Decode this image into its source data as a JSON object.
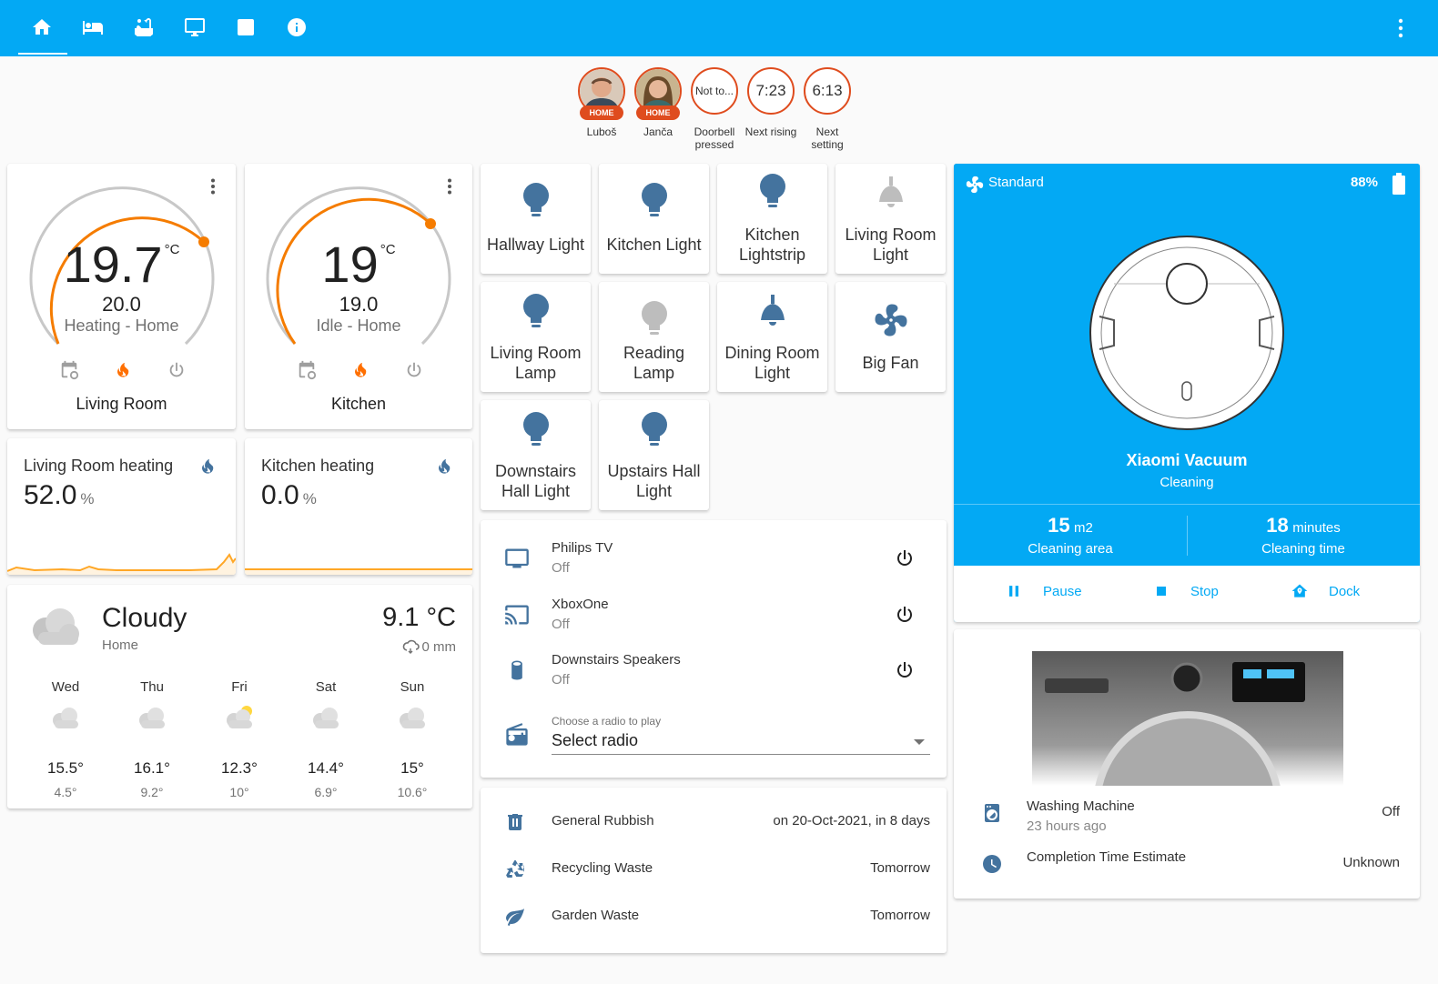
{
  "toolbar": {
    "tabs": [
      "home-icon",
      "bed-icon",
      "bathtub-icon",
      "monitor-icon",
      "image-icon",
      "info-icon"
    ],
    "menu": "dots-vertical-icon",
    "accent": "#03a9f4"
  },
  "badges": [
    {
      "value": "",
      "tag": "HOME",
      "label": "Luboš"
    },
    {
      "value": "",
      "tag": "HOME",
      "label": "Janča"
    },
    {
      "value": "Not to...",
      "tag": "",
      "label": "Doorbell pressed"
    },
    {
      "value": "7:23",
      "tag": "",
      "label": "Next rising"
    },
    {
      "value": "6:13",
      "tag": "",
      "label": "Next setting"
    }
  ],
  "thermostats": [
    {
      "current": "19.7",
      "unit": "°C",
      "target": "20.0",
      "mode": "Heating - Home",
      "name": "Living Room",
      "level": 0.73
    },
    {
      "current": "19",
      "unit": "°C",
      "target": "19.0",
      "mode": "Idle - Home",
      "name": "Kitchen",
      "level": 0.66
    }
  ],
  "sensors": [
    {
      "title": "Living Room heating",
      "value": "52.0",
      "unit": "%"
    },
    {
      "title": "Kitchen heating",
      "value": "0.0",
      "unit": "%"
    }
  ],
  "weather": {
    "condition": "Cloudy",
    "location": "Home",
    "temperature": "9.1 °C",
    "precipitation": "0 mm",
    "forecast": [
      {
        "day": "Wed",
        "high": "15.5°",
        "low": "4.5°",
        "icon": "cloudy-icon"
      },
      {
        "day": "Thu",
        "high": "16.1°",
        "low": "9.2°",
        "icon": "cloudy-icon"
      },
      {
        "day": "Fri",
        "high": "12.3°",
        "low": "10°",
        "icon": "partly-cloudy-icon"
      },
      {
        "day": "Sat",
        "high": "14.4°",
        "low": "6.9°",
        "icon": "cloudy-icon"
      },
      {
        "day": "Sun",
        "high": "15°",
        "low": "10.6°",
        "icon": "cloudy-icon"
      }
    ]
  },
  "lights": [
    {
      "name": "Hallway Light",
      "icon": "bulb-icon",
      "on": true
    },
    {
      "name": "Kitchen Light",
      "icon": "bulb-icon",
      "on": true
    },
    {
      "name": "Kitchen Lightstrip",
      "icon": "bulb-icon",
      "on": true
    },
    {
      "name": "Living Room Light",
      "icon": "ceiling-light-icon",
      "on": false
    },
    {
      "name": "Living Room Lamp",
      "icon": "bulb-icon",
      "on": true
    },
    {
      "name": "Reading Lamp",
      "icon": "bulb-icon",
      "on": false
    },
    {
      "name": "Dining Room Light",
      "icon": "ceiling-light-icon",
      "on": true
    },
    {
      "name": "Big Fan",
      "icon": "fan-icon",
      "on": true
    },
    {
      "name": "Downstairs Hall Light",
      "icon": "bulb-icon",
      "on": true
    },
    {
      "name": "Upstairs Hall Light",
      "icon": "bulb-icon",
      "on": true
    }
  ],
  "media": [
    {
      "name": "Philips TV",
      "state": "Off",
      "icon": "tv-icon"
    },
    {
      "name": "XboxOne",
      "state": "Off",
      "icon": "cast-icon"
    },
    {
      "name": "Downstairs Speakers",
      "state": "Off",
      "icon": "speaker-icon"
    }
  ],
  "radio": {
    "label": "Choose a radio to play",
    "value": "Select radio"
  },
  "waste": [
    {
      "name": "General Rubbish",
      "when": "on 20-Oct-2021, in 8 days",
      "icon": "trash-icon"
    },
    {
      "name": "Recycling Waste",
      "when": "Tomorrow",
      "icon": "recycle-icon"
    },
    {
      "name": "Garden Waste",
      "when": "Tomorrow",
      "icon": "leaf-icon"
    }
  ],
  "vacuum": {
    "mode": "Standard",
    "battery": "88%",
    "name": "Xiaomi Vacuum",
    "status": "Cleaning",
    "area_value": "15",
    "area_unit": "m2",
    "area_label": "Cleaning area",
    "time_value": "18",
    "time_unit": "minutes",
    "time_label": "Cleaning time",
    "pause": "Pause",
    "stop": "Stop",
    "dock": "Dock"
  },
  "washer": {
    "name": "Washing Machine",
    "updated": "23 hours ago",
    "state": "Off",
    "estimate_label": "Completion Time Estimate",
    "estimate_value": "Unknown"
  }
}
